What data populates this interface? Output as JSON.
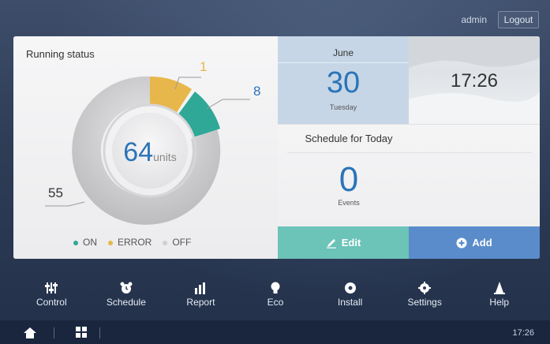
{
  "header": {
    "user": "admin",
    "logout_label": "Logout"
  },
  "running_status": {
    "title": "Running status",
    "total": "64",
    "total_unit": "units",
    "on_count": "8",
    "error_count": "1",
    "off_count": "55",
    "legend": [
      "ON",
      "ERROR",
      "OFF"
    ],
    "colors": {
      "on": "#2fa897",
      "error": "#e6b84a",
      "off": "#cfcfd1"
    }
  },
  "calendar": {
    "month": "June",
    "day": "30",
    "weekday": "Tuesday"
  },
  "time": {
    "display": "17:26"
  },
  "schedule": {
    "title": "Schedule for Today",
    "count": "0",
    "label": "Events"
  },
  "actions": {
    "edit_label": "Edit",
    "add_label": "Add"
  },
  "dock": [
    {
      "label": "Control",
      "icon": "sliders-icon"
    },
    {
      "label": "Schedule",
      "icon": "alarm-clock-icon"
    },
    {
      "label": "Report",
      "icon": "bar-chart-icon"
    },
    {
      "label": "Eco",
      "icon": "lightbulb-icon"
    },
    {
      "label": "Install",
      "icon": "disc-icon"
    },
    {
      "label": "Settings",
      "icon": "gear-icon"
    },
    {
      "label": "Help",
      "icon": "cone-icon"
    }
  ],
  "footer": {
    "clock": "17:26"
  }
}
